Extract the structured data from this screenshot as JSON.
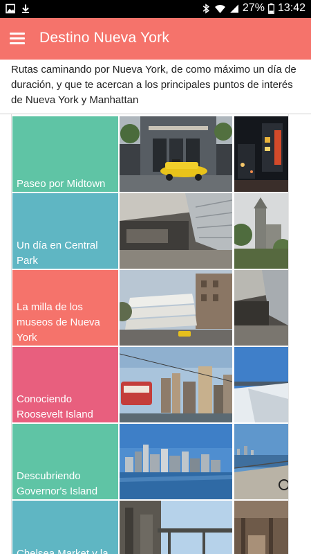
{
  "status_bar": {
    "battery": "27%",
    "time": "13:42",
    "left_icons": [
      "image-icon",
      "download-icon"
    ],
    "right_icons": [
      "bluetooth-icon",
      "wifi-icon",
      "signal-icon",
      "battery-icon"
    ]
  },
  "app_bar": {
    "title": "Destino Nueva York",
    "menu_icon": "hamburger-menu-icon",
    "color": "#f5736b"
  },
  "description": "Rutas caminando por Nueva York, de como máximo un día de duración, y que te acercan a los principales puntos de interés de Nueva York y Manhattan",
  "routes": [
    {
      "name": "Paseo por Midtown",
      "color": "#5fc4a5",
      "photo_a": "midtown-street-taxi",
      "photo_b": "times-square-night"
    },
    {
      "name": "Un día en Central Park",
      "color": "#5fb6c3",
      "photo_a": "museum-glass-hall",
      "photo_b": "castle-tower"
    },
    {
      "name": "La milla de los museos de Nueva York",
      "color": "#f5736b",
      "photo_a": "guggenheim-museum",
      "photo_b": "museum-glass-hall-2"
    },
    {
      "name": "Conociendo Roosevelt Island",
      "color": "#e85f7e",
      "photo_a": "roosevelt-tram-skyline",
      "photo_b": "riverside-park-slope"
    },
    {
      "name": "Descubriendo Governor's Island",
      "color": "#5fc4a5",
      "photo_a": "manhattan-skyline-water",
      "photo_b": "waterfront-promenade-bike"
    },
    {
      "name": "Chelsea Market y la",
      "color": "#5fb6c3",
      "photo_a": "high-line-walkway",
      "photo_b": "market-interior"
    }
  ]
}
